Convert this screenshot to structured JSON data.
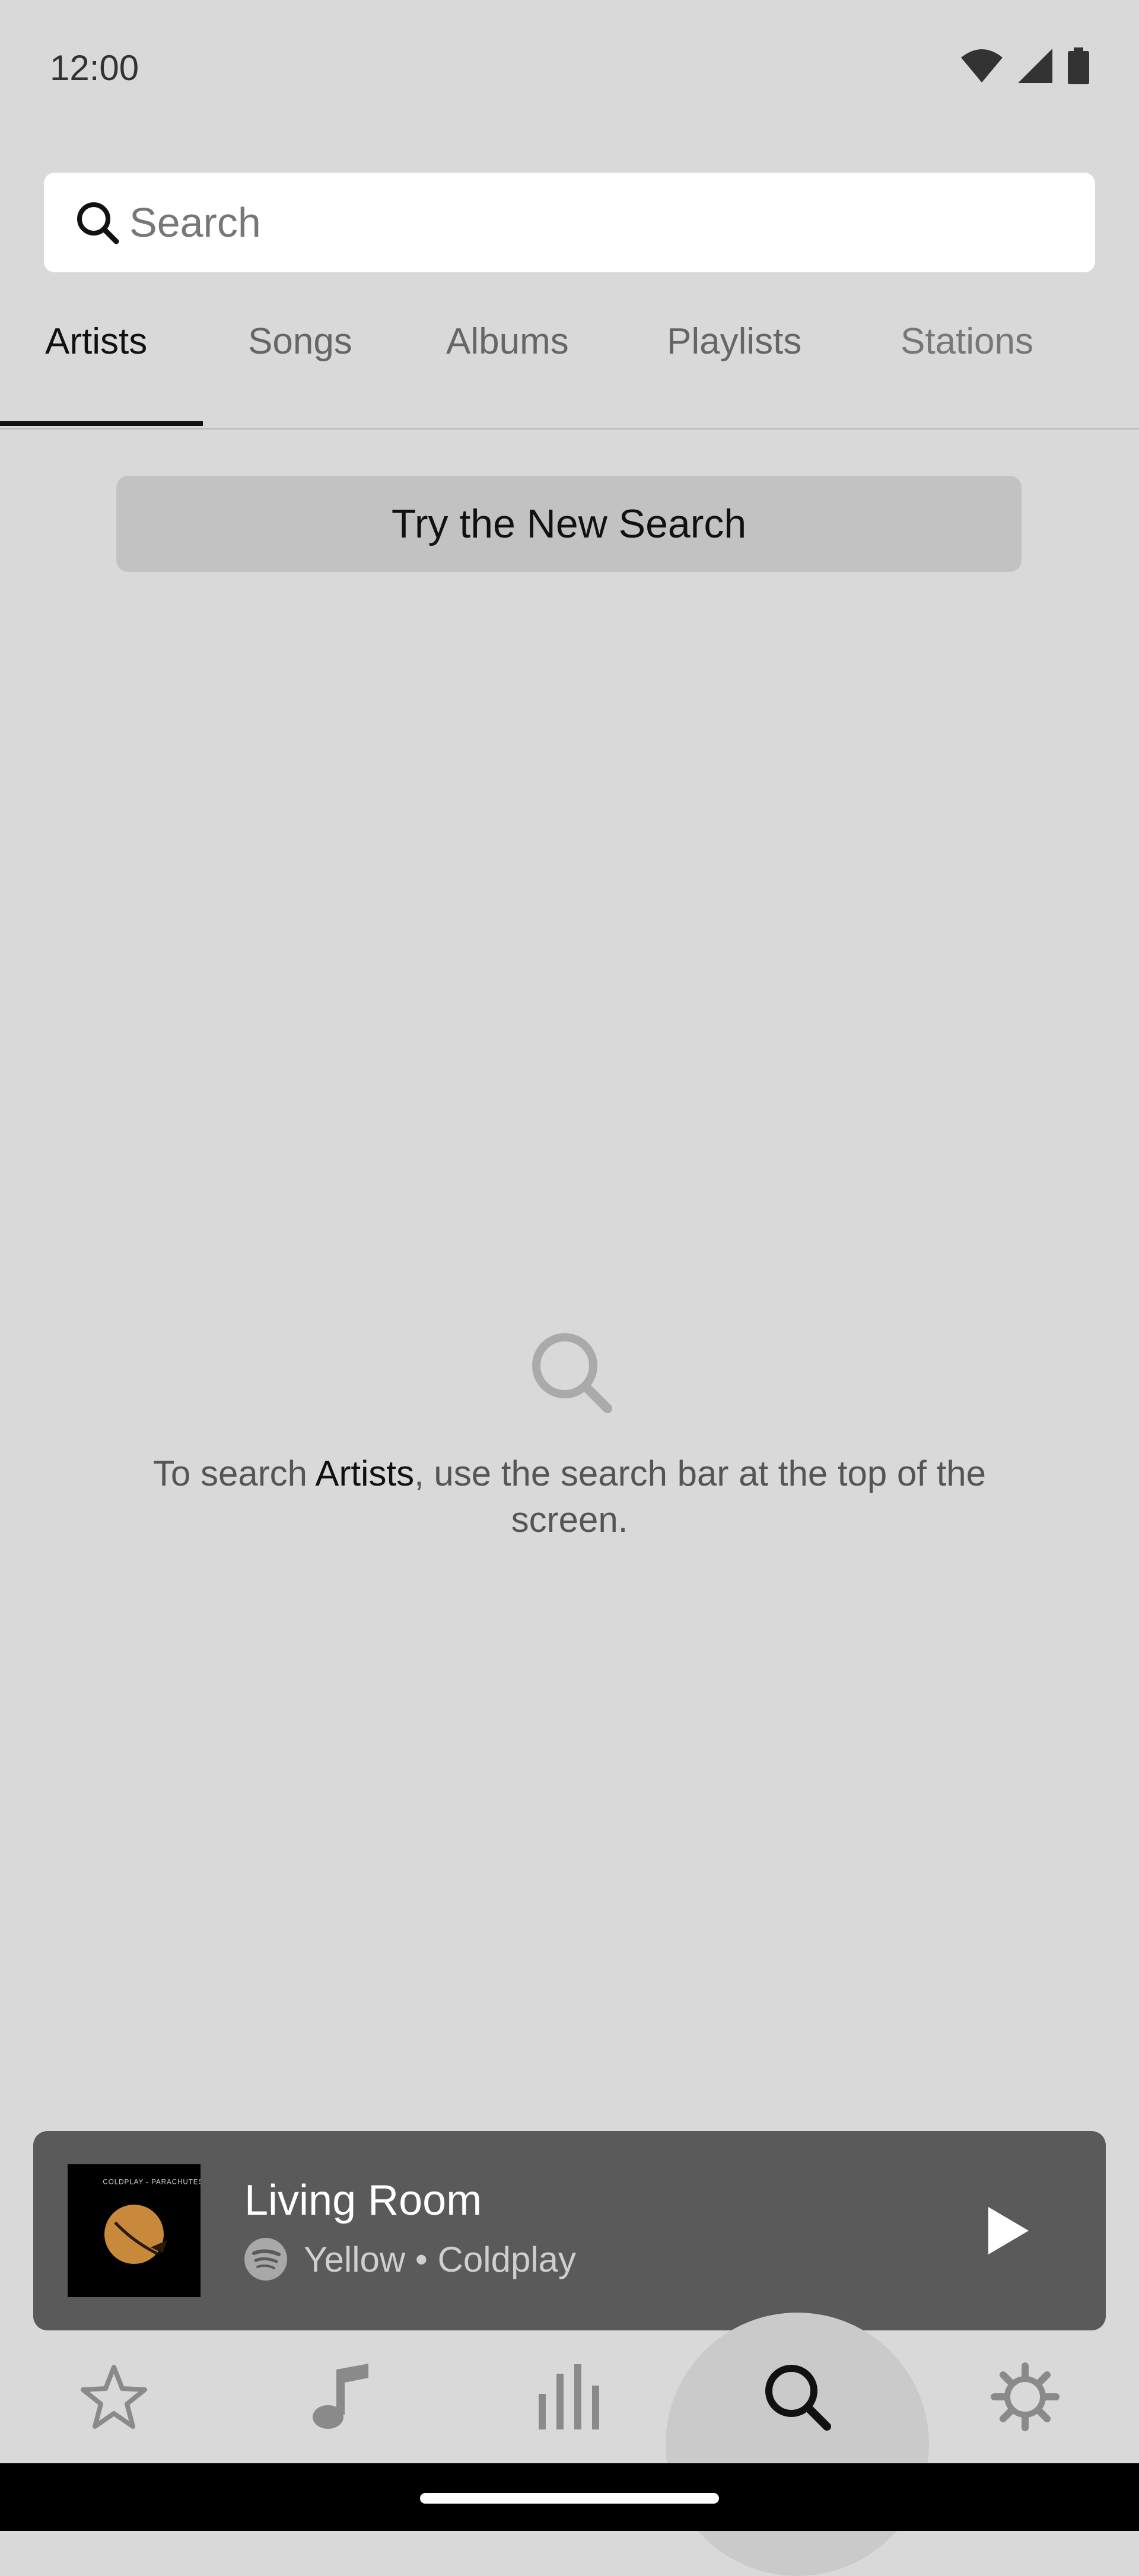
{
  "status_bar": {
    "time": "12:00"
  },
  "search": {
    "placeholder": "Search"
  },
  "tabs": [
    {
      "label": "Artists",
      "active": true
    },
    {
      "label": "Songs",
      "active": false
    },
    {
      "label": "Albums",
      "active": false
    },
    {
      "label": "Playlists",
      "active": false
    },
    {
      "label": "Stations",
      "active": false
    }
  ],
  "try_new_search": {
    "label": "Try the New Search"
  },
  "empty_state": {
    "icon": "search-icon",
    "text_before": "To search ",
    "text_strong": "Artists",
    "text_after": ", use the search bar at the top of the screen."
  },
  "mini_player": {
    "room": "Living Room",
    "track": "Yellow • Coldplay",
    "source_icon": "spotify-icon",
    "album_art_text": "COLDPLAY - PARACHUTES",
    "play_icon": "play-icon"
  },
  "bottom_nav": [
    {
      "icon": "star-icon",
      "active": false
    },
    {
      "icon": "music-note-icon",
      "active": false
    },
    {
      "icon": "equalizer-icon",
      "active": false
    },
    {
      "icon": "search-icon",
      "active": true
    },
    {
      "icon": "gear-icon",
      "active": false
    }
  ],
  "colors": {
    "background": "#d9d9d9",
    "mini_player_bg": "#5a5a5a",
    "try_button_bg": "#c2c2c2",
    "album_orange": "#c8893a"
  }
}
